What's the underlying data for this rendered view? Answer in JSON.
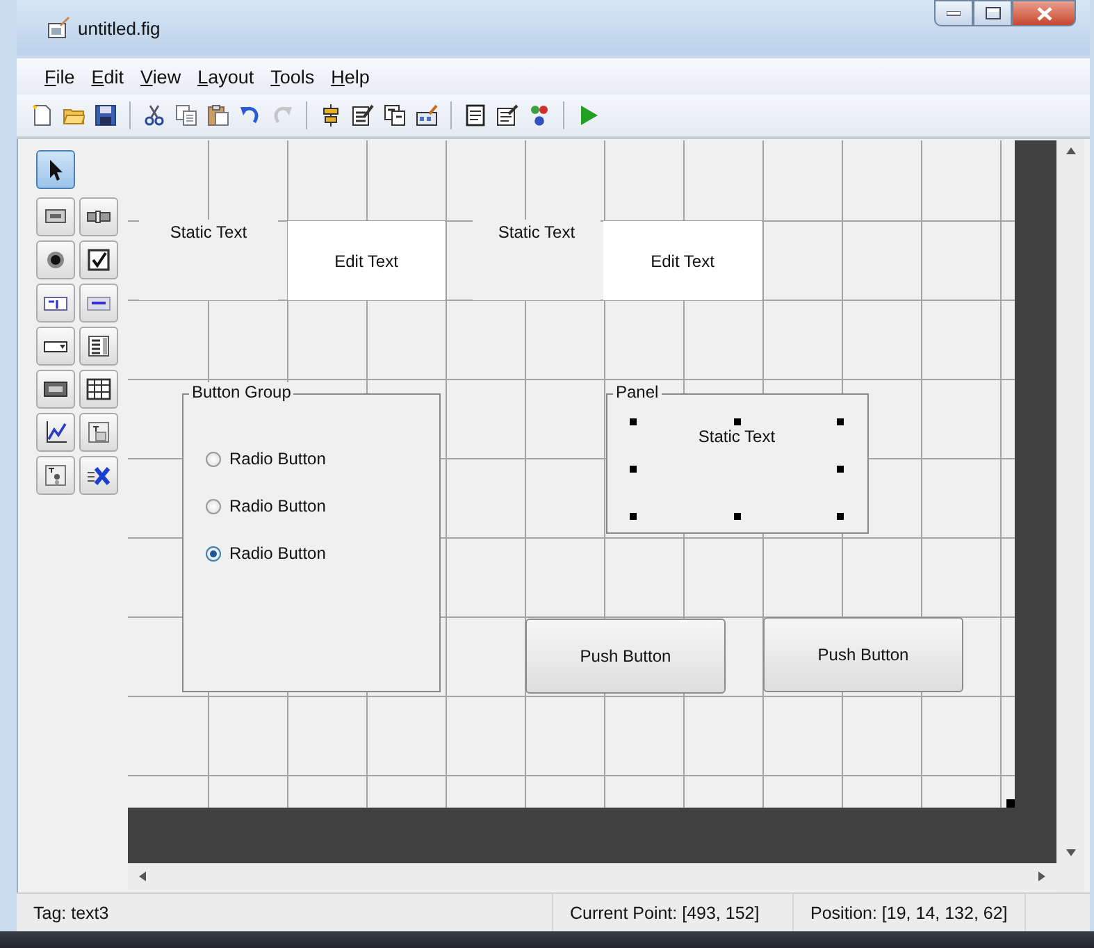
{
  "window": {
    "title": "untitled.fig"
  },
  "menu": [
    {
      "label": "File"
    },
    {
      "label": "Edit"
    },
    {
      "label": "View"
    },
    {
      "label": "Layout"
    },
    {
      "label": "Tools"
    },
    {
      "label": "Help"
    }
  ],
  "toolbar": [
    [
      {
        "kind": "new",
        "disabled": false
      },
      {
        "kind": "open",
        "disabled": false
      },
      {
        "kind": "save",
        "disabled": false
      }
    ],
    [
      {
        "kind": "cut",
        "disabled": false
      },
      {
        "kind": "copy",
        "disabled": false
      },
      {
        "kind": "paste",
        "disabled": false
      },
      {
        "kind": "undo",
        "disabled": false
      },
      {
        "kind": "redo",
        "disabled": true
      }
    ],
    [
      {
        "kind": "align",
        "disabled": false
      },
      {
        "kind": "menu-editor",
        "disabled": false
      },
      {
        "kind": "tab-order",
        "disabled": false
      },
      {
        "kind": "toolbar-editor",
        "disabled": false
      }
    ],
    [
      {
        "kind": "editor",
        "disabled": false
      },
      {
        "kind": "inspector",
        "disabled": false
      },
      {
        "kind": "browser",
        "disabled": false
      }
    ],
    [
      {
        "kind": "run",
        "disabled": false
      }
    ]
  ],
  "palette": [
    {
      "kind": "select",
      "selected": true
    },
    {
      "kind": "pushbutton",
      "selected": false
    },
    {
      "kind": "slider",
      "selected": false
    },
    {
      "kind": "radio",
      "selected": false
    },
    {
      "kind": "checkbox",
      "selected": false
    },
    {
      "kind": "edit",
      "selected": false
    },
    {
      "kind": "text",
      "selected": false
    },
    {
      "kind": "popup",
      "selected": false
    },
    {
      "kind": "listbox",
      "selected": false
    },
    {
      "kind": "toggle",
      "selected": false
    },
    {
      "kind": "table",
      "selected": false
    },
    {
      "kind": "axes",
      "selected": false
    },
    {
      "kind": "panel",
      "selected": false
    },
    {
      "kind": "buttongroup",
      "selected": false
    },
    {
      "kind": "activex",
      "selected": false
    }
  ],
  "canvas": {
    "components": [
      {
        "kind": "statictext",
        "text": "Static Text",
        "selected": false
      },
      {
        "kind": "edittext",
        "text": "Edit Text",
        "selected": false
      },
      {
        "kind": "statictext",
        "text": "Static Text",
        "selected": false
      },
      {
        "kind": "edittext",
        "text": "Edit Text",
        "selected": false
      },
      {
        "kind": "buttongroup",
        "title": "Button Group",
        "selected": false,
        "children": [
          {
            "kind": "radio",
            "text": "Radio Button",
            "selected": false
          },
          {
            "kind": "radio",
            "text": "Radio Button",
            "selected": false
          },
          {
            "kind": "radio",
            "text": "Radio Button",
            "selected": true
          }
        ]
      },
      {
        "kind": "panel",
        "title": "Panel",
        "selected": false,
        "children": [
          {
            "kind": "statictext",
            "text": "Static Text",
            "selected": true
          }
        ]
      },
      {
        "kind": "pushbutton",
        "text": "Push Button",
        "selected": false
      },
      {
        "kind": "pushbutton",
        "text": "Push Button",
        "selected": false
      }
    ]
  },
  "status_bar": {
    "tag": "Tag: text3",
    "current_point": "Current Point:  [493, 152]",
    "position": "Position: [19, 14, 132, 62]"
  }
}
